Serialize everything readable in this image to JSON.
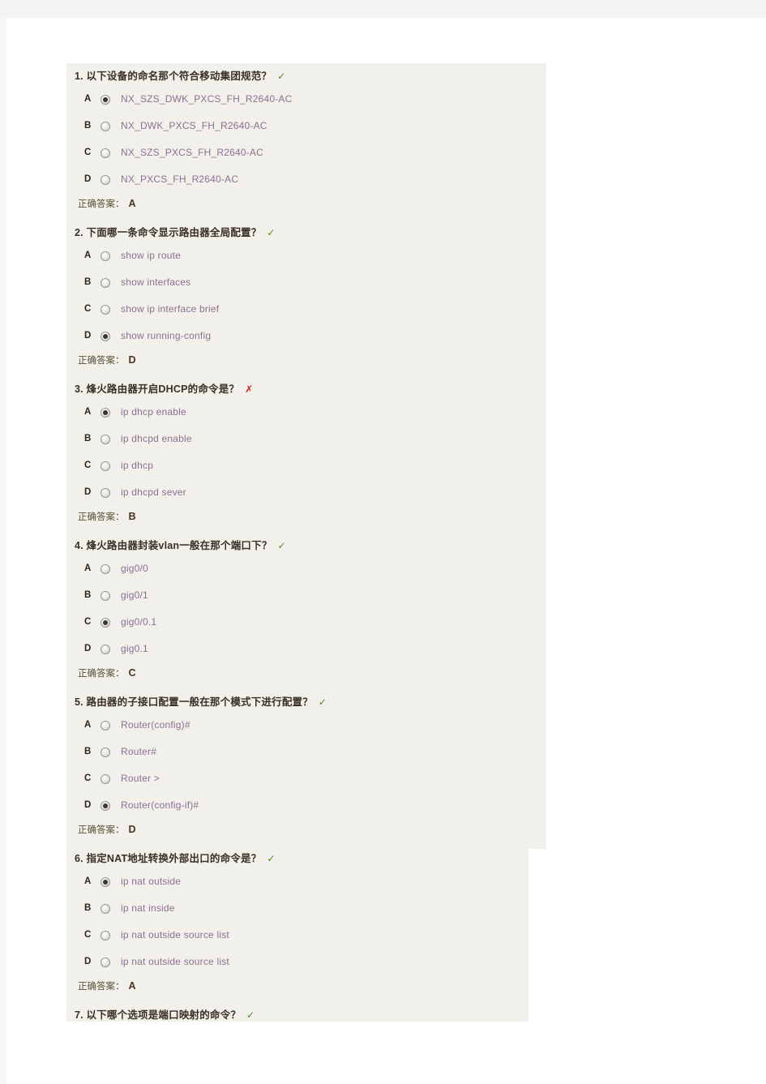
{
  "document": {
    "answer_label": "正确答案：",
    "mark_correct": "✓",
    "mark_wrong": "✗",
    "colors": {
      "panel_bg": "#f1f0ea",
      "page_bg": "#ffffff",
      "top_strip": "#f4f4f4",
      "question_text": "#3a2f23",
      "option_text": "#8d6f93",
      "answer_label": "#5a5136",
      "answer_value": "#4a3322",
      "mark_correct": "#4f8b1f",
      "mark_wrong": "#d81e1e"
    }
  },
  "questions": [
    {
      "number": "1.",
      "text": "以下设备的命名那个符合移动集团规范？",
      "status": "correct",
      "status_mark": "✓",
      "options": [
        {
          "letter": "A",
          "text": "NX_SZS_DWK_PXCS_FH_R2640-AC",
          "selected": true
        },
        {
          "letter": "B",
          "text": "NX_DWK_PXCS_FH_R2640-AC",
          "selected": false
        },
        {
          "letter": "C",
          "text": "NX_SZS_PXCS_FH_R2640-AC",
          "selected": false
        },
        {
          "letter": "D",
          "text": "NX_PXCS_FH_R2640-AC",
          "selected": false
        }
      ],
      "answer": "A"
    },
    {
      "number": "2.",
      "text": "下面哪一条命令显示路由器全局配置？",
      "status": "correct",
      "status_mark": "✓",
      "options": [
        {
          "letter": "A",
          "text": "show ip route",
          "selected": false
        },
        {
          "letter": "B",
          "text": "show interfaces",
          "selected": false
        },
        {
          "letter": "C",
          "text": "show ip interface brief",
          "selected": false
        },
        {
          "letter": "D",
          "text": "show running-config",
          "selected": true
        }
      ],
      "answer": "D"
    },
    {
      "number": "3.",
      "text": "烽火路由器开启DHCP的命令是？",
      "status": "wrong",
      "status_mark": "✗",
      "options": [
        {
          "letter": "A",
          "text": "ip dhcp enable",
          "selected": true
        },
        {
          "letter": "B",
          "text": "ip dhcpd enable",
          "selected": false
        },
        {
          "letter": "C",
          "text": "ip dhcp",
          "selected": false
        },
        {
          "letter": "D",
          "text": "ip dhcpd sever",
          "selected": false
        }
      ],
      "answer": "B"
    },
    {
      "number": "4.",
      "text": "烽火路由器封装vlan一般在那个端口下？",
      "status": "correct",
      "status_mark": "✓",
      "options": [
        {
          "letter": "A",
          "text": "gig0/0",
          "selected": false
        },
        {
          "letter": "B",
          "text": "gig0/1",
          "selected": false
        },
        {
          "letter": "C",
          "text": "gig0/0.1",
          "selected": true
        },
        {
          "letter": "D",
          "text": "gig0.1",
          "selected": false
        }
      ],
      "answer": "C"
    },
    {
      "number": "5.",
      "text": "路由器的子接口配置一般在那个模式下进行配置？",
      "status": "correct",
      "status_mark": "✓",
      "options": [
        {
          "letter": "A",
          "text": "Router(config)#",
          "selected": false
        },
        {
          "letter": "B",
          "text": "Router#",
          "selected": false
        },
        {
          "letter": "C",
          "text": "Router >",
          "selected": false
        },
        {
          "letter": "D",
          "text": "Router(config-if)#",
          "selected": true
        }
      ],
      "answer": "D"
    },
    {
      "number": "6.",
      "text": "指定NAT地址转换外部出口的命令是？",
      "status": "correct",
      "status_mark": "✓",
      "options": [
        {
          "letter": "A",
          "text": "ip nat outside",
          "selected": true
        },
        {
          "letter": "B",
          "text": "ip nat inside",
          "selected": false
        },
        {
          "letter": "C",
          "text": "ip nat outside source list",
          "selected": false
        },
        {
          "letter": "D",
          "text": "ip nat outside source list",
          "selected": false
        }
      ],
      "answer": "A"
    },
    {
      "number": "7.",
      "text": "以下哪个选项是端口映射的命令？",
      "status": "correct",
      "status_mark": "✓",
      "options": [],
      "answer": null
    }
  ]
}
